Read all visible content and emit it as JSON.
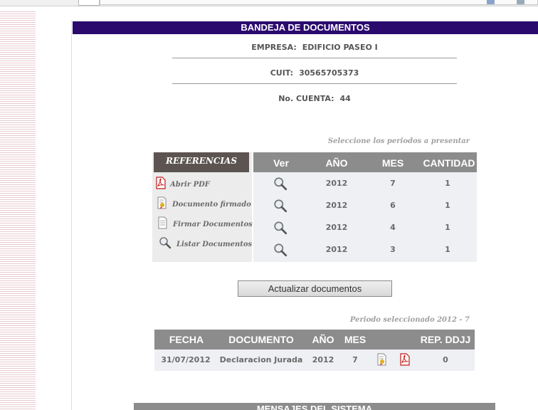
{
  "header": {
    "title": "BANDEJA DE DOCUMENTOS"
  },
  "info": {
    "empresa_label": "EMPRESA:",
    "empresa_value": "EDIFICIO PASEO I",
    "cuit_label": "CUIT:",
    "cuit_value": "30565705373",
    "cuenta_label": "No. CUENTA:",
    "cuenta_value": "44"
  },
  "periods_note": "Seleccione los periodos a presentar",
  "references": {
    "title": "REFERENCIAS",
    "items": [
      {
        "label": "Abrir PDF",
        "icon": "pdf-icon"
      },
      {
        "label": "Documento firmado",
        "icon": "signed-document-icon"
      },
      {
        "label": "Firmar Documentos",
        "icon": "document-icon"
      },
      {
        "label": "Listar Documentos",
        "icon": "magnifier-icon"
      }
    ]
  },
  "periods": {
    "headers": [
      "Ver",
      "AÑO",
      "MES",
      "CANTIDAD"
    ],
    "rows": [
      {
        "anio": "2012",
        "mes": "7",
        "cantidad": "1"
      },
      {
        "anio": "2012",
        "mes": "6",
        "cantidad": "1"
      },
      {
        "anio": "2012",
        "mes": "4",
        "cantidad": "1"
      },
      {
        "anio": "2012",
        "mes": "3",
        "cantidad": "1"
      }
    ]
  },
  "update_button": "Actualizar documentos",
  "selected_note": "Periodo seleccionado 2012 - 7",
  "documents": {
    "headers": [
      "FECHA",
      "DOCUMENTO",
      "AÑO",
      "MES",
      "REP. DDJJ"
    ],
    "rows": [
      {
        "fecha": "31/07/2012",
        "documento": "Declaracion Jurada",
        "anio": "2012",
        "mes": "7",
        "rep": "0"
      }
    ]
  },
  "messages_title": "MENSAJES DEL SISTEMA",
  "colors": {
    "header": "#2b0a6e",
    "table_header": "#8c8c8c",
    "table_bg": "#eef0f3",
    "refs_title": "#5b5451"
  }
}
